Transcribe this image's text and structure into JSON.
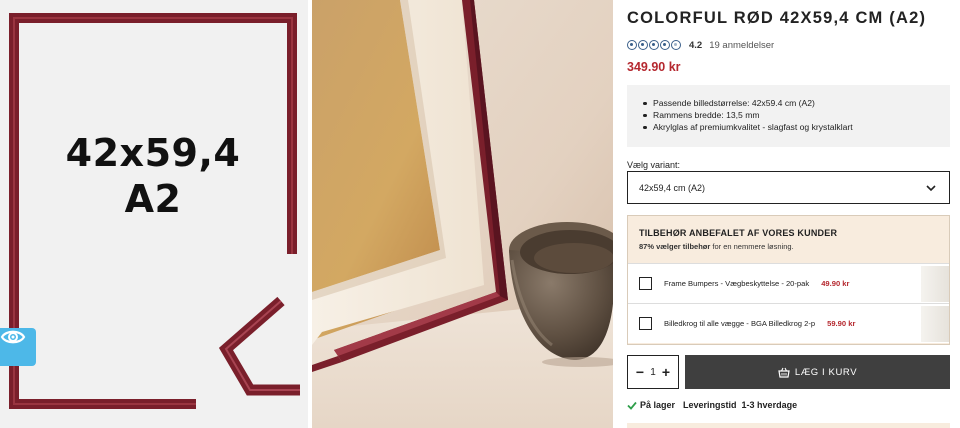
{
  "gallery": {
    "size_label_line1": "42x59,4",
    "size_label_line2": "A2",
    "zoom_icon": "eye-icon"
  },
  "product": {
    "title": "COLORFUL RØD 42X59,4 CM (A2)",
    "rating_value": "4.2",
    "rating_count": "19 anmeldelser",
    "rating_stars": 4.2,
    "price": "349.90 kr",
    "features": [
      "Passende billedstørrelse: 42x59.4 cm (A2)",
      "Rammens bredde: 13,5 mm",
      "Akrylglas af premiumkvalitet - slagfast og krystalklart"
    ]
  },
  "variant": {
    "label": "Vælg variant:",
    "selected": "42x59,4 cm (A2)",
    "icon": "chevron-down-icon"
  },
  "accessories": {
    "heading": "TILBEHØR ANBEFALET AF VORES KUNDER",
    "sub_bold": "87% vælger tilbehør",
    "sub_rest": " for en nemmere løsning.",
    "items": [
      {
        "name": "Frame Bumpers - Vægbeskyttelse - 20-pak",
        "price": "49.90 kr",
        "checked": false
      },
      {
        "name": "Billedkrog til alle vægge - BGA Billedkrog 2-p",
        "price": "59.90 kr",
        "checked": false
      }
    ]
  },
  "purchase": {
    "minus": "−",
    "quantity": "1",
    "plus": "+",
    "cart_label": "LÆG I KURV",
    "cart_icon": "basket-icon"
  },
  "stock": {
    "status": "På lager",
    "delivery_label": "Leveringstid",
    "delivery_value": "1-3 hverdage"
  },
  "colors": {
    "frame_red": "#7a1f2b",
    "price_red": "#b5282f",
    "accent_blue": "#4db8e8",
    "stock_green": "#2e9e4a",
    "cart_dark": "#3f3f3f",
    "accessory_bg": "#f8ecde"
  }
}
